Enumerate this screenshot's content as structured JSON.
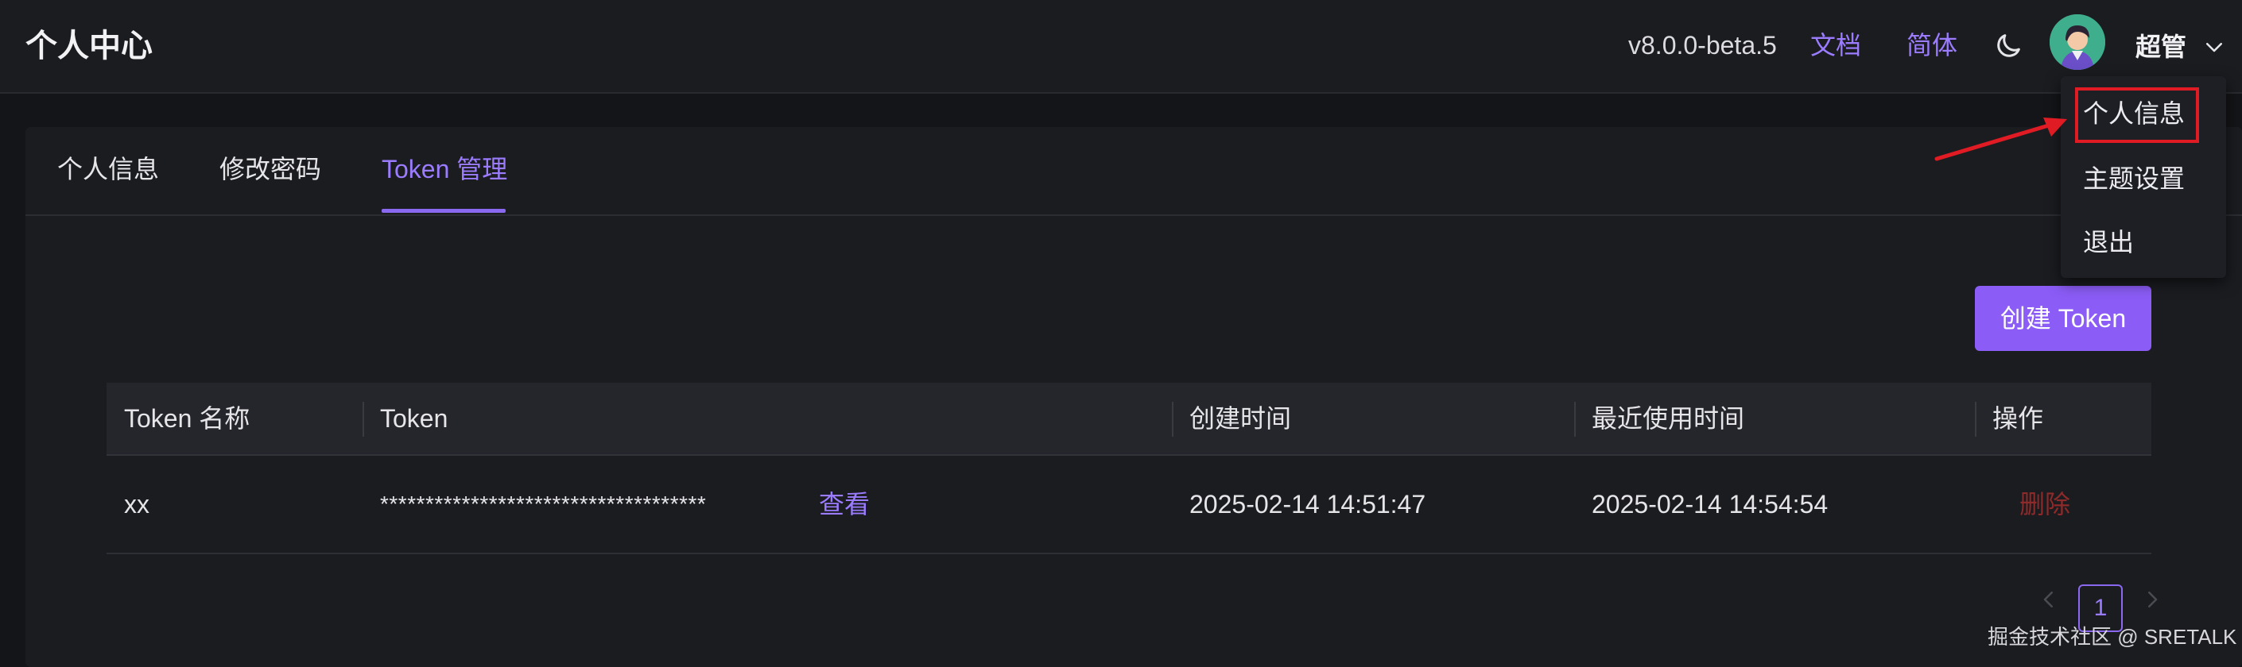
{
  "header": {
    "title": "个人中心",
    "version": "v8.0.0-beta.5",
    "docs_label": "文档",
    "lang_label": "简体",
    "theme_icon": "moon-icon",
    "user_name": "超管"
  },
  "user_menu": {
    "items": [
      {
        "label": "个人信息"
      },
      {
        "label": "主题设置"
      },
      {
        "label": "退出"
      }
    ],
    "highlight_color": "#e01b24"
  },
  "tabs": [
    {
      "label": "个人信息",
      "active": false
    },
    {
      "label": "修改密码",
      "active": false
    },
    {
      "label": "Token 管理",
      "active": true
    }
  ],
  "create_button": {
    "label": "创建 Token"
  },
  "token_table": {
    "columns": [
      "Token 名称",
      "Token",
      "创建时间",
      "最近使用时间",
      "操作"
    ],
    "rows": [
      {
        "name": "xx",
        "token": "************************************",
        "view": "查看",
        "created": "2025-02-14 14:51:47",
        "last_used": "2025-02-14 14:54:54",
        "action": "删除"
      }
    ]
  },
  "pagination": {
    "current_page": "1"
  },
  "watermark": "掘金技术社区 @ SRETALK",
  "colors": {
    "accent": "#8b5cf6",
    "link": "#9b7cff",
    "danger": "#8e2a2a",
    "background": "#141518"
  }
}
